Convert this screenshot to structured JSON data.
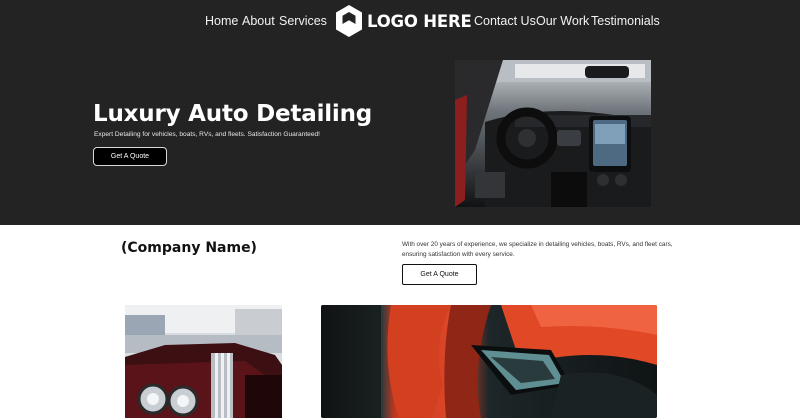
{
  "nav": {
    "left": [
      {
        "label": "Home"
      },
      {
        "label": "About"
      },
      {
        "label": "Services"
      }
    ],
    "logo_text": "LOGO HERE",
    "right": [
      {
        "label": "Contact Us"
      },
      {
        "label": "Our Work"
      },
      {
        "label": "Testimonials"
      }
    ]
  },
  "hero": {
    "title": "Luxury Auto Detailing",
    "subtitle": "Expert Detailing for vehicles, boats, RVs, and fleets. Satisfaction Guaranteed!",
    "cta_label": "Get A Quote",
    "image_icon": "car-interior-photo"
  },
  "about": {
    "company_name": "(Company Name)",
    "text": "With over 20 years of experience, we specialize in detailing vehicles, boats, RVs, and fleet cars, ensuring satisfaction with every service.",
    "cta_label": "Get A Quote"
  },
  "gallery": {
    "images": [
      {
        "icon": "classic-car-photo"
      },
      {
        "icon": "red-sports-car-photo"
      }
    ]
  },
  "colors": {
    "hero_bg": "#232323",
    "page_bg": "#ffffff",
    "button_dark": "#000000",
    "text_light": "#ffffff"
  }
}
